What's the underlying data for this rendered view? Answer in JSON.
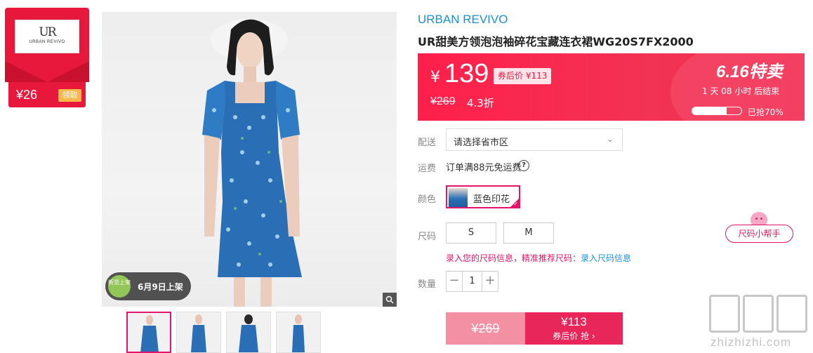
{
  "coupon": {
    "logo_mark": "UR",
    "logo_text": "URBAN REVIVO",
    "amount": "¥26",
    "claim_label": "领取"
  },
  "main_image": {
    "new_badge_icon_text": "新货上架",
    "new_badge_date": "6月9日上架",
    "zoom_icon": "magnifier-icon"
  },
  "product": {
    "brand": "URBAN REVIVO",
    "title": "UR甜美方领泡泡袖碎花宝藏连衣裙WG20S7FX2000"
  },
  "price_panel": {
    "currency": "¥",
    "price": "139",
    "coupon_price": "券后价 ¥113",
    "original_price": "¥269",
    "discount": "4.3折",
    "promo_title": "6.16特卖",
    "countdown": "1 天 08 小时 后结束",
    "sold_fraction": 0.7,
    "sold_text": "已抢70%",
    "colors": {
      "start": "#ff1f4b",
      "end": "#ef2d55"
    }
  },
  "shipping": {
    "label": "配送",
    "select_value": "请选择省市区"
  },
  "freight": {
    "label": "运费",
    "text": "订单满88元免运费",
    "help_icon": "?"
  },
  "color": {
    "label": "颜色",
    "selected": "蓝色印花"
  },
  "size": {
    "label": "尺码",
    "options": [
      "S",
      "M"
    ],
    "helper_button": "尺码小帮手",
    "hint_text": "录入您的尺码信息，精准推荐尺码：",
    "hint_link": "录入尺码信息"
  },
  "quantity": {
    "label": "数量",
    "minus": "−",
    "value": "1",
    "plus": "+"
  },
  "buy": {
    "original_price": "¥269",
    "coupon_price": "¥113",
    "coupon_label": "券后价 抢 ›"
  },
  "watermark": {
    "text": "zhizhizhi.com"
  },
  "accent": {
    "pink": "#e4146a",
    "blue": "#1a8fd8",
    "red": "#e8173c"
  }
}
